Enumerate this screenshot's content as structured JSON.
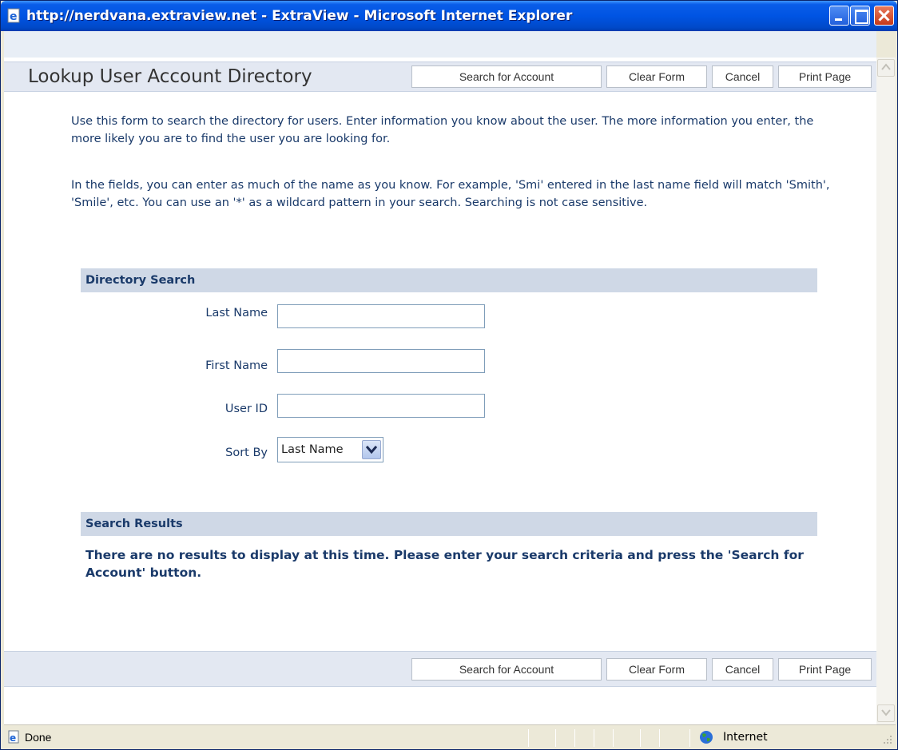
{
  "window": {
    "title": "http://nerdvana.extraview.net - ExtraView - Microsoft Internet Explorer"
  },
  "page": {
    "title": "Lookup User Account Directory",
    "buttons": {
      "search": "Search for Account",
      "clear": "Clear Form",
      "cancel": "Cancel",
      "print": "Print Page"
    },
    "intro1": "Use this form to search the directory for users. Enter information you know about the user. The more information you enter, the more likely you are to find the user you are looking for.",
    "intro2": "In the fields, you can enter as much of the name as you know. For example, 'Smi' entered in the last name field will match 'Smith', 'Smile', etc. You can use an '*' as a wildcard pattern in your search. Searching is not case sensitive.",
    "directory_search": {
      "heading": "Directory Search",
      "fields": {
        "last_name": {
          "label": "Last Name",
          "value": ""
        },
        "first_name": {
          "label": "First Name",
          "value": ""
        },
        "user_id": {
          "label": "User ID",
          "value": ""
        },
        "sort_by": {
          "label": "Sort By",
          "value": "Last Name"
        }
      }
    },
    "search_results": {
      "heading": "Search Results",
      "message": "There are no results to display at this time. Please enter your search criteria and press the 'Search for Account' button."
    }
  },
  "statusbar": {
    "status": "Done",
    "zone": "Internet"
  },
  "icons": {
    "title": "ie-page-icon",
    "status": "ie-page-icon",
    "zone": "globe-icon"
  },
  "colors": {
    "titlebar": "#0054e3",
    "header_bg": "#e3e8f2",
    "section_bg": "#cfd8e6",
    "text": "#1a3a6a"
  }
}
